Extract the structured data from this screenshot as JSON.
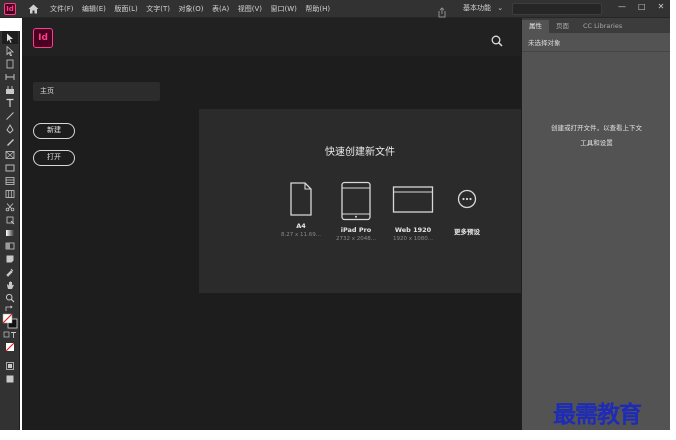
{
  "menubar": {
    "app_badge": "Id",
    "items": [
      "文件(F)",
      "编辑(E)",
      "版面(L)",
      "文字(T)",
      "对象(O)",
      "表(A)",
      "视图(V)",
      "窗口(W)",
      "帮助(H)"
    ],
    "workspace_label": "基本功能",
    "window_controls": [
      "—",
      "□",
      "✕"
    ]
  },
  "home": {
    "logo": "Id",
    "nav_home_label": "主页",
    "new_button": "新建",
    "open_button": "打开",
    "quick_create_title": "快速创建新文件",
    "presets": [
      {
        "name": "A4",
        "size": "8.27 x 11.69...",
        "icon": "page-icon"
      },
      {
        "name": "iPad Pro",
        "size": "2732 x 2048...",
        "icon": "tablet-icon"
      },
      {
        "name": "Web 1920",
        "size": "1920 x 1080...",
        "icon": "browser-icon"
      },
      {
        "name": "更多预设",
        "size": "",
        "icon": "more-icon"
      }
    ]
  },
  "right_panel": {
    "tabs": [
      "属性",
      "页面",
      "CC Libraries"
    ],
    "subtitle": "未选择对象",
    "message_line1": "创建或打开文件，以查看上下文",
    "message_line2": "工具和设置"
  },
  "watermark": "最需教育",
  "colors": {
    "accent": "#ff3b8b",
    "background": "#1d1d1d",
    "panel": "#535353",
    "watermark": "#1d2bb8"
  }
}
